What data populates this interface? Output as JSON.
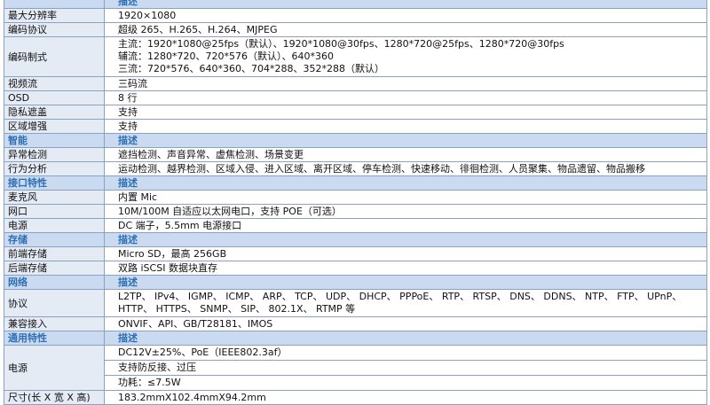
{
  "rows": [
    {
      "type": "sec",
      "key": "描述",
      "value": ""
    },
    {
      "type": "row",
      "key": "最大分辨率",
      "value": "1920×1080"
    },
    {
      "type": "row",
      "key": "编码协议",
      "value": "超级 265、H.265、H.264、MJPEG"
    },
    {
      "type": "row",
      "key": "编码制式",
      "lines": [
        "主流：1920*1080@25fps（默认）、1920*1080@30fps、1280*720@25fps、1280*720@30fps",
        "辅流：1280*720、720*576（默认）、640*360",
        "三流：720*576、640*360、704*288、352*288（默认）"
      ]
    },
    {
      "type": "row",
      "key": "视频流",
      "value": "三码流"
    },
    {
      "type": "row",
      "key": "OSD",
      "value": "8 行"
    },
    {
      "type": "row",
      "key": "隐私遮盖",
      "value": "支持"
    },
    {
      "type": "row",
      "key": "区域增强",
      "value": "支持"
    },
    {
      "type": "sec",
      "key": "智能",
      "value": "描述"
    },
    {
      "type": "row",
      "key": "异常检测",
      "value": "遮挡检测、声音异常、虚焦检测、场景变更"
    },
    {
      "type": "row",
      "key": "行为分析",
      "value": "运动检测、越界检测、区域入侵、进入区域、离开区域、停车检测、快速移动、徘徊检测、人员聚集、物品遗留、物品搬移"
    },
    {
      "type": "sec",
      "key": "接口特性",
      "value": "描述"
    },
    {
      "type": "row",
      "key": "麦克风",
      "value": "内置 Mic"
    },
    {
      "type": "row",
      "key": "网口",
      "value": "10M/100M 自适应以太网电口，支持 POE（可选）"
    },
    {
      "type": "row",
      "key": "电源",
      "value": "DC 端子，5.5mm 电源接口"
    },
    {
      "type": "sec",
      "key": "存储",
      "value": "描述"
    },
    {
      "type": "row",
      "key": "前端存储",
      "value": "Micro SD，最高 256GB"
    },
    {
      "type": "row",
      "key": "后端存储",
      "value": "双路 iSCSI 数据块直存"
    },
    {
      "type": "sec",
      "key": "网络",
      "value": "描述"
    },
    {
      "type": "row",
      "key": "协议",
      "lines": [
        "L2TP、 IPv4、 IGMP、 ICMP、 ARP、 TCP、 UDP、 DHCP、 PPPoE、 RTP、 RTSP、 DNS、 DDNS、 NTP、 FTP、 UPnP、",
        "HTTP、 HTTPS、 SNMP、 SIP、 802.1X、 RTMP 等"
      ]
    },
    {
      "type": "row",
      "key": "兼容接入",
      "value": "ONVIF、API、GB/T28181、IMOS"
    },
    {
      "type": "sec",
      "key": "通用特性",
      "value": "描述"
    },
    {
      "type": "row",
      "key": "电源",
      "sub": [
        "DC12V±25%、PoE（IEEE802.3af）",
        "支持防反接、过压",
        "功耗：≤7.5W"
      ]
    },
    {
      "type": "row",
      "key": "尺寸(长 X 宽 X 高)",
      "value": "183.2mmX102.4mmX94.2mm"
    }
  ]
}
